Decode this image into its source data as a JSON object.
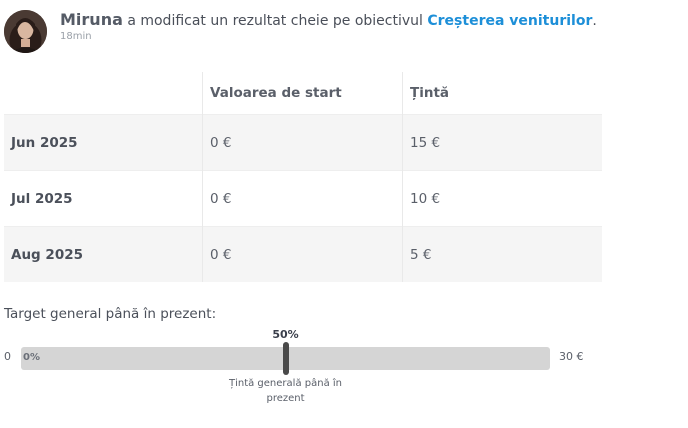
{
  "activity": {
    "user": "Miruna",
    "action": "a modificat un rezultat cheie pe obiectivul",
    "goal": "Creșterea veniturilor",
    "suffix": ".",
    "time": "18min"
  },
  "table": {
    "headers": [
      "",
      "Valoarea de start",
      "Țintă"
    ],
    "rows": [
      {
        "period": "Jun 2025",
        "start": "0 €",
        "target": "15 €"
      },
      {
        "period": "Jul 2025",
        "start": "0 €",
        "target": "10 €"
      },
      {
        "period": "Aug 2025",
        "start": "0 €",
        "target": "5 €"
      }
    ]
  },
  "progress": {
    "title": "Target general până în prezent:",
    "min": "0",
    "max": "30 €",
    "current": "0%",
    "current_fraction": 0.0,
    "target_label": "50%",
    "target_fraction": 0.5,
    "target_caption": "Țintă generală până în prezent"
  },
  "colors": {
    "link": "#1d8fd8",
    "track": "#d5d5d5",
    "marker": "#4a4a4a",
    "row_shade": "#f5f5f5"
  }
}
